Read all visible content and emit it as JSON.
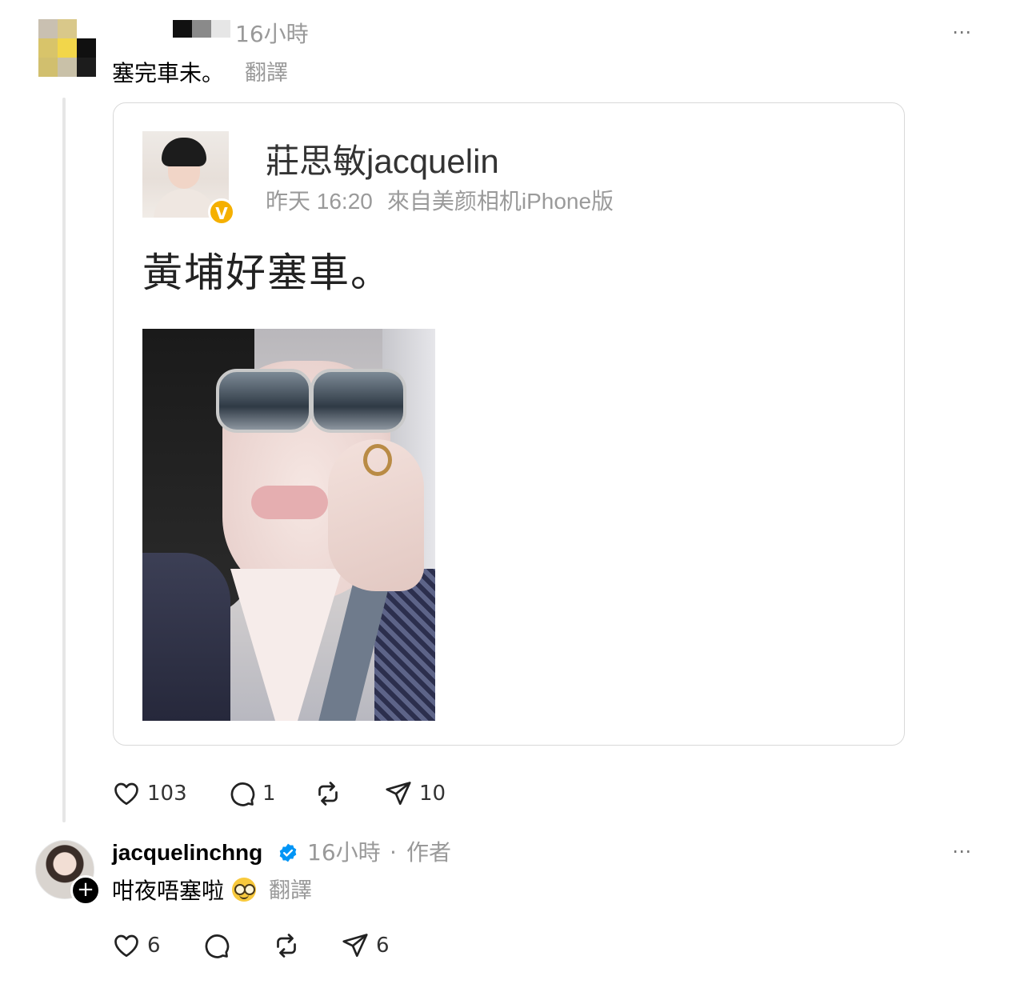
{
  "post": {
    "time": "16小時",
    "text": "塞完車未。",
    "translate_label": "翻譯",
    "more_icon": "⋯",
    "embedded_weibo": {
      "name": "莊思敏jacquelin",
      "time": "昨天 16:20",
      "source": "來自美颜相机iPhone版",
      "verified_badge": "V",
      "text": "黃埔好塞車。"
    },
    "actions": {
      "likes": "103",
      "replies": "1",
      "shares": "10"
    }
  },
  "reply": {
    "username": "jacquelinchng",
    "time": "16小時",
    "separator": "·",
    "author_label": "作者",
    "text": "咁夜唔塞啦",
    "translate_label": "翻譯",
    "follow_icon": "+",
    "more_icon": "⋯",
    "actions": {
      "likes": "6",
      "shares": "6"
    }
  },
  "colors": {
    "secondary_text": "#999999",
    "verified_blue": "#0095f6",
    "weibo_verified": "#f5b000",
    "border": "#d9d9d9"
  }
}
